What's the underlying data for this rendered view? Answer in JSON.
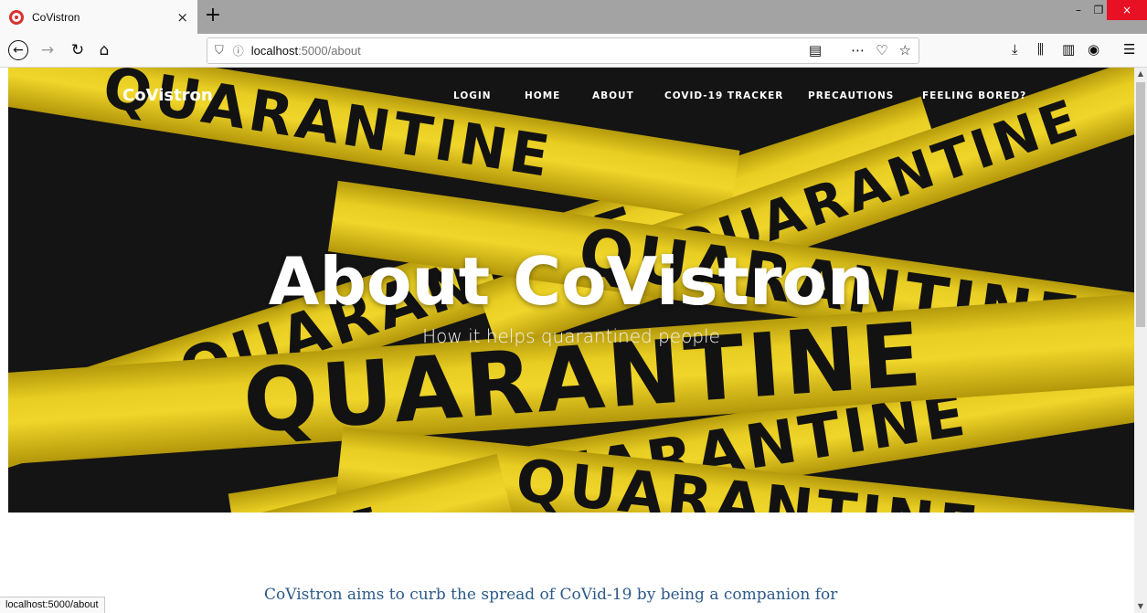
{
  "browser": {
    "tab_title": "CoVistron",
    "tab_close": "×",
    "new_tab": "+",
    "url_host": "localhost",
    "url_path": ":5000/about",
    "status_url": "localhost:5000/about",
    "window_min": "–",
    "window_max": "❐",
    "window_close": "×"
  },
  "site": {
    "brand": "CoVistron",
    "nav": {
      "login": "LOGIN",
      "home": "HOME",
      "about": "ABOUT",
      "tracker": "COVID-19 TRACKER",
      "precautions": "PRECAUTIONS",
      "bored": "FEELING BORED?"
    },
    "hero_title": "About CoVistron",
    "hero_subtitle": "How it helps quarantined people",
    "hero_tape_words": [
      "QUARANTINE",
      "QUARANTINE",
      "QUARANTINE",
      "QUARANTINE",
      "QUARANTINE",
      "QUARANTINE",
      "QUARANTINE",
      "TINE"
    ],
    "body_text": "CoVistron aims to curb the spread of CoVid-19 by being a companion for"
  },
  "colors": {
    "tape_yellow": "#f0d52a",
    "hero_dark": "#141414",
    "body_link": "#2d5a8a",
    "window_close": "#e81123"
  }
}
